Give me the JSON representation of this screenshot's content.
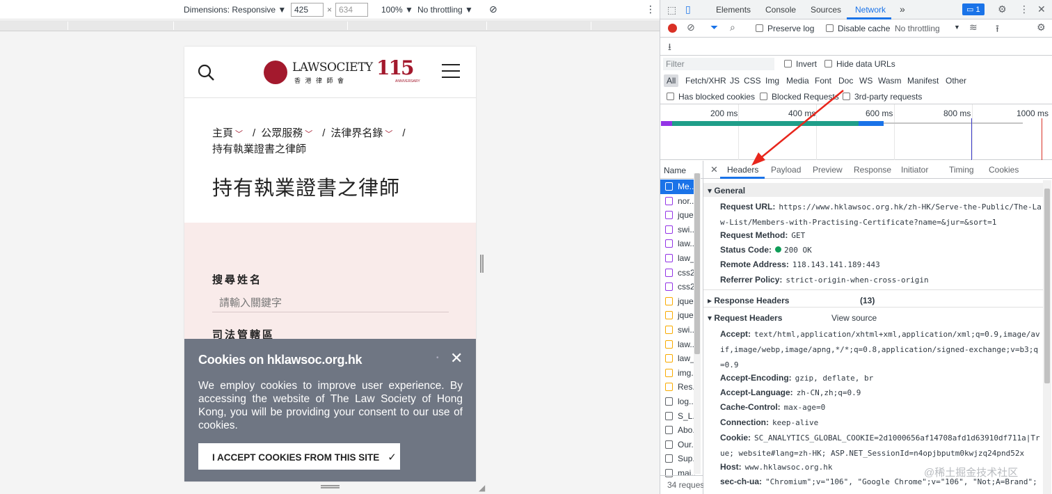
{
  "device_toolbar": {
    "dimensions_label": "Dimensions: Responsive ▼",
    "width": "425",
    "height": "634",
    "times": "×",
    "zoom": "100% ▼",
    "throttling": "No throttling ▼",
    "more": "⋮"
  },
  "page": {
    "logo_text": "LAWSOCIETY",
    "logo_sub": "香 港 律 師 會",
    "anniversary": "115",
    "anniversary_sub": "ANNIVERSARY",
    "breadcrumb": [
      "主頁",
      "公眾服務",
      "法律界名錄"
    ],
    "breadcrumb_current": "持有執業證書之律師",
    "breadcrumb_sep": "/",
    "title": "持有執業證書之律師",
    "search_label": "搜尋姓名",
    "search_placeholder": "請輸入關鍵字",
    "jurisdiction_label": "司法管轄區"
  },
  "cookie_banner": {
    "title": "Cookies on hklawsoc.org.hk",
    "body": "We employ cookies to improve user experience. By accessing the website of The Law Society of Hong Kong, you will be providing your consent to our use of cookies.",
    "accept_label": "I ACCEPT COOKIES FROM THIS SITE",
    "accept_check": "✓",
    "close": "✕"
  },
  "devtools": {
    "tabs": [
      "Elements",
      "Console",
      "Sources",
      "Network"
    ],
    "active_tab": "Network",
    "more_tabs": "»",
    "issues_count": "1",
    "preserve_log": "Preserve log",
    "disable_cache": "Disable cache",
    "throttling": "No throttling",
    "filter_placeholder": "Filter",
    "invert": "Invert",
    "hide_data_urls": "Hide data URLs",
    "types": [
      "All",
      "Fetch/XHR",
      "JS",
      "CSS",
      "Img",
      "Media",
      "Font",
      "Doc",
      "WS",
      "Wasm",
      "Manifest",
      "Other"
    ],
    "has_blocked_cookies": "Has blocked cookies",
    "blocked_requests": "Blocked Requests",
    "third_party": "3rd-party requests",
    "timeline_labels": [
      "200 ms",
      "400 ms",
      "600 ms",
      "800 ms",
      "1000 ms"
    ],
    "name_header": "Name",
    "requests": [
      {
        "name": "Me...",
        "kind": "doc"
      },
      {
        "name": "nor...",
        "kind": "css"
      },
      {
        "name": "jque...",
        "kind": "css"
      },
      {
        "name": "swi...",
        "kind": "css"
      },
      {
        "name": "law...",
        "kind": "css"
      },
      {
        "name": "law_...",
        "kind": "css"
      },
      {
        "name": "css2...",
        "kind": "css"
      },
      {
        "name": "css2...",
        "kind": "css"
      },
      {
        "name": "jque...",
        "kind": "js"
      },
      {
        "name": "jque...",
        "kind": "js"
      },
      {
        "name": "swi...",
        "kind": "js"
      },
      {
        "name": "law...",
        "kind": "js"
      },
      {
        "name": "law_...",
        "kind": "js"
      },
      {
        "name": "img...",
        "kind": "js"
      },
      {
        "name": "Res...",
        "kind": "js"
      },
      {
        "name": "log...",
        "kind": "img"
      },
      {
        "name": "S_L...",
        "kind": "img"
      },
      {
        "name": "Abo...",
        "kind": "img"
      },
      {
        "name": "Our...",
        "kind": "img"
      },
      {
        "name": "Sup...",
        "kind": "img"
      },
      {
        "name": "mai...",
        "kind": "img"
      }
    ],
    "requests_footer": "34 reques",
    "detail_tabs": [
      "Headers",
      "Payload",
      "Preview",
      "Response",
      "Initiator",
      "Timing",
      "Cookies"
    ],
    "active_detail_tab": "Headers",
    "close": "✕",
    "general": {
      "title": "General",
      "request_url_k": "Request URL:",
      "request_url": "https://www.hklawsoc.org.hk/zh-HK/Serve-the-Public/The-Law-List/Members-with-Practising-Certificate?name=&jur=&sort=1",
      "method_k": "Request Method:",
      "method": "GET",
      "status_k": "Status Code:",
      "status": "200 OK",
      "remote_k": "Remote Address:",
      "remote": "118.143.141.189:443",
      "referrer_k": "Referrer Policy:",
      "referrer": "strict-origin-when-cross-origin"
    },
    "response_headers": {
      "title": "Response Headers",
      "count": "(13)"
    },
    "request_headers": {
      "title": "Request Headers",
      "view_source": "View source",
      "accept_k": "Accept:",
      "accept": "text/html,application/xhtml+xml,application/xml;q=0.9,image/avif,image/webp,image/apng,*/*;q=0.8,application/signed-exchange;v=b3;q=0.9",
      "encoding_k": "Accept-Encoding:",
      "encoding": "gzip, deflate, br",
      "language_k": "Accept-Language:",
      "language": "zh-CN,zh;q=0.9",
      "cache_k": "Cache-Control:",
      "cache": "max-age=0",
      "connection_k": "Connection:",
      "connection": "keep-alive",
      "cookie_k": "Cookie:",
      "cookie": "SC_ANALYTICS_GLOBAL_COOKIE=2d1000656af14708afd1d63910df711a|True; website#lang=zh-HK; ASP.NET_SessionId=n4opjbputm0kwjzq24pnd52x",
      "host_k": "Host:",
      "host": "www.hklawsoc.org.hk",
      "secchua_k": "sec-ch-ua:",
      "secchua": "\"Chromium\";v=\"106\", \"Google Chrome\";v=\"106\", \"Not;A=Brand\";v"
    }
  },
  "watermark": "@稀土掘金技术社区",
  "colors": {
    "accent": "#1a73e8",
    "brand": "#a3192d",
    "cookie_bg": "#6f7683",
    "pink_bg": "#f9ebea",
    "arrow": "#e8261c"
  }
}
